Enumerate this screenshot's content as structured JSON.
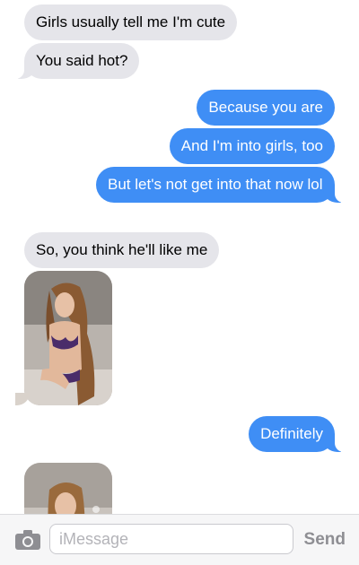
{
  "messages": [
    {
      "from": "them",
      "text": "Girls usually tell me I'm cute"
    },
    {
      "from": "them",
      "text": "You said hot?"
    },
    {
      "from": "me",
      "text": "Because you are"
    },
    {
      "from": "me",
      "text": "And I'm into girls, too"
    },
    {
      "from": "me",
      "text": "But let's not get into that now lol"
    },
    {
      "from": "them",
      "text": "So, you think he'll like me"
    },
    {
      "from": "them",
      "type": "photo"
    },
    {
      "from": "me",
      "text": "Definitely"
    },
    {
      "from": "them",
      "type": "photo"
    }
  ],
  "composer": {
    "placeholder": "iMessage",
    "send_label": "Send",
    "camera_icon": "camera-icon"
  },
  "colors": {
    "sent_bubble": "#3f8ef5",
    "received_bubble": "#e5e5ea",
    "send_text": "#8e8e93"
  }
}
